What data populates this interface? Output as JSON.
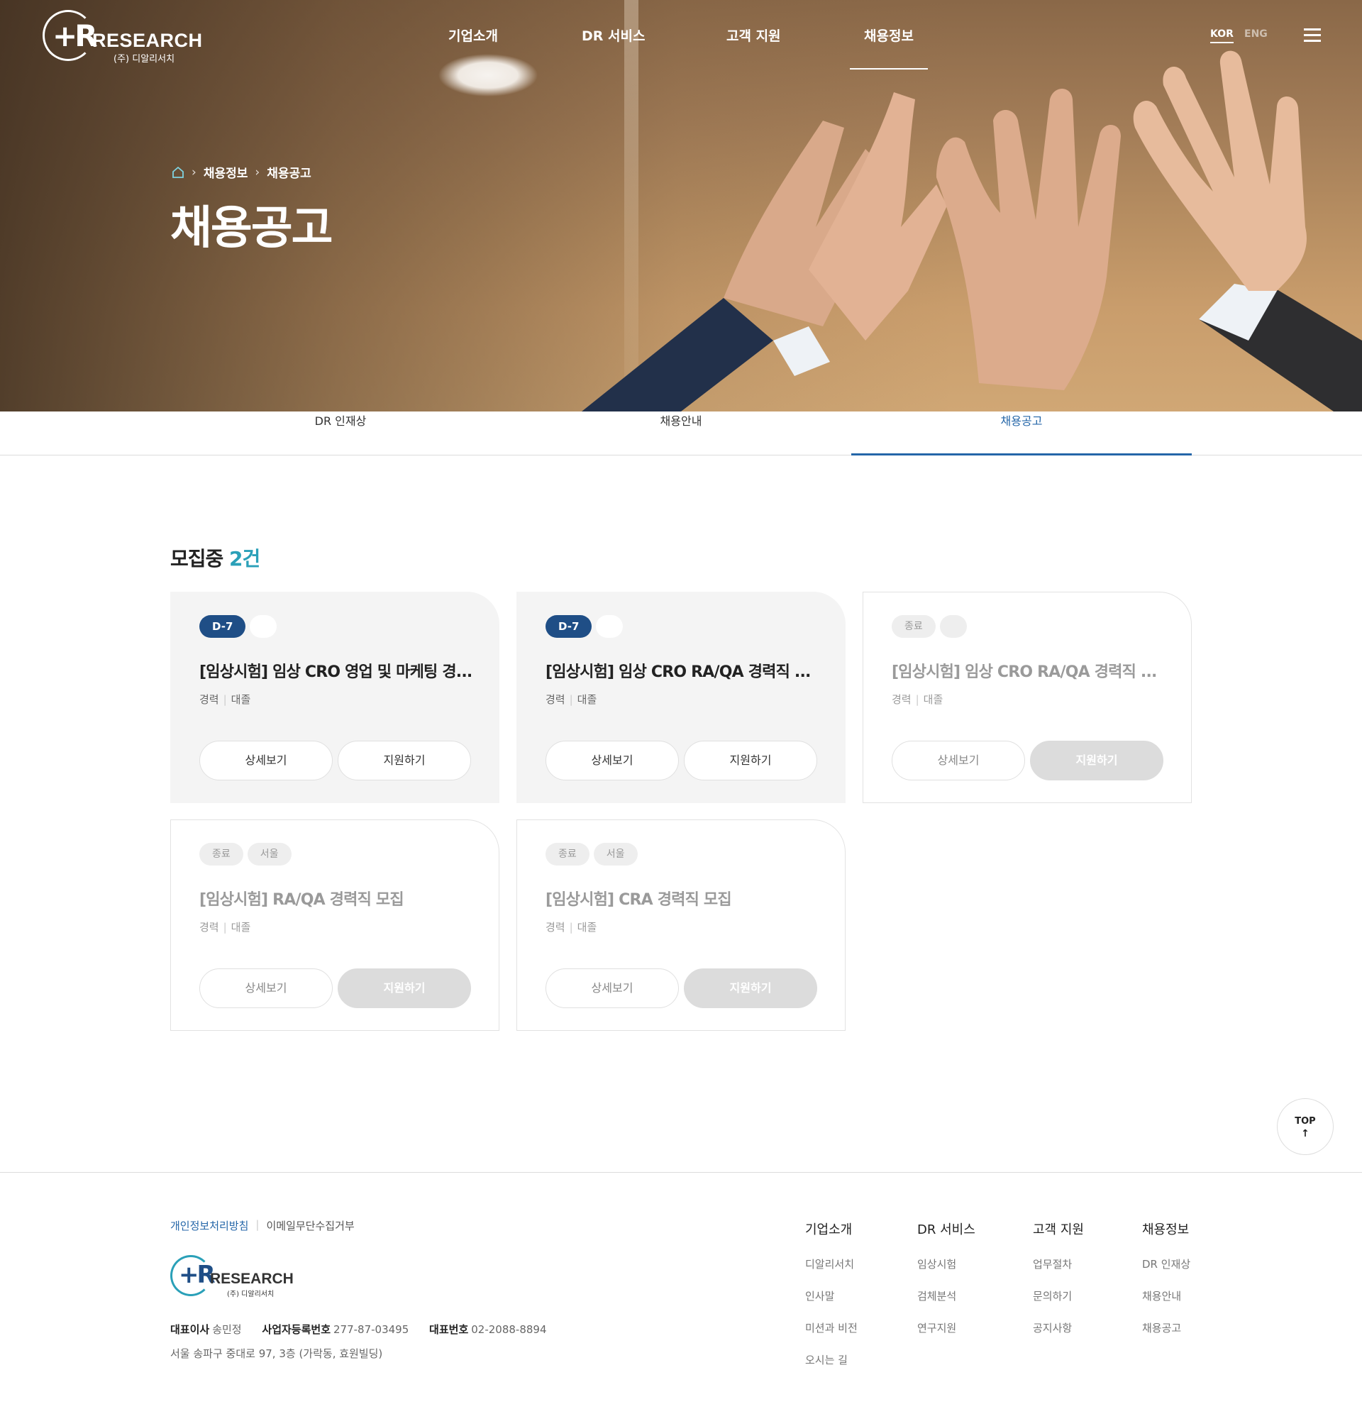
{
  "brand": {
    "mark": "+R",
    "name": "RESEARCH",
    "sub": "(주) 디알리서치"
  },
  "gnb": {
    "items": [
      "기업소개",
      "DR 서비스",
      "고객 지원",
      "채용정보"
    ],
    "lang": {
      "kor": "KOR",
      "eng": "ENG"
    }
  },
  "hero": {
    "breadcrumb": [
      "채용정보",
      "채용공고"
    ],
    "title": "채용공고"
  },
  "tabs": [
    "DR 인재상",
    "채용안내",
    "채용공고"
  ],
  "listing": {
    "label": "모집중",
    "count": "2건",
    "cards": [
      {
        "badges": [
          "D-7"
        ],
        "title": "[임상시험] 임상 CRO 영업 및 마케팅 경...",
        "career": "경력",
        "edu": "대졸",
        "detail": "상세보기",
        "apply": "지원하기"
      },
      {
        "badges": [
          "D-7"
        ],
        "title": "[임상시험] 임상 CRO RA/QA 경력직 ...",
        "career": "경력",
        "edu": "대졸",
        "detail": "상세보기",
        "apply": "지원하기"
      },
      {
        "badges": [
          "종료"
        ],
        "title": "[임상시험] 임상 CRO RA/QA 경력직 ...",
        "career": "경력",
        "edu": "대졸",
        "detail": "상세보기",
        "apply": "지원하기"
      },
      {
        "badges": [
          "종료",
          "서울"
        ],
        "title": "[임상시험] RA/QA 경력직 모집",
        "career": "경력",
        "edu": "대졸",
        "detail": "상세보기",
        "apply": "지원하기"
      },
      {
        "badges": [
          "종료",
          "서울"
        ],
        "title": "[임상시험] CRA 경력직 모집",
        "career": "경력",
        "edu": "대졸",
        "detail": "상세보기",
        "apply": "지원하기"
      }
    ]
  },
  "top": {
    "label": "TOP",
    "arrow": "↑"
  },
  "footer": {
    "links": [
      "개인정보처리방침",
      "이메일무단수집거부"
    ],
    "info": {
      "ceo_label": "대표이사",
      "ceo": "송민정",
      "biz_label": "사업자등록번호",
      "biz": "277-87-03495",
      "tel_label": "대표번호",
      "tel": "02-2088-8894"
    },
    "address": "서울 송파구 중대로 97, 3층 (가락동, 효원빌딩)",
    "columns": [
      {
        "title": "기업소개",
        "links": [
          "디알리서치",
          "인사말",
          "미션과 비전",
          "오시는 길"
        ]
      },
      {
        "title": "DR 서비스",
        "links": [
          "임상시험",
          "검체분석",
          "연구지원"
        ]
      },
      {
        "title": "고객 지원",
        "links": [
          "업무절차",
          "문의하기",
          "공지사항"
        ]
      },
      {
        "title": "채용정보",
        "links": [
          "DR 인재상",
          "채용안내",
          "채용공고"
        ]
      }
    ]
  }
}
